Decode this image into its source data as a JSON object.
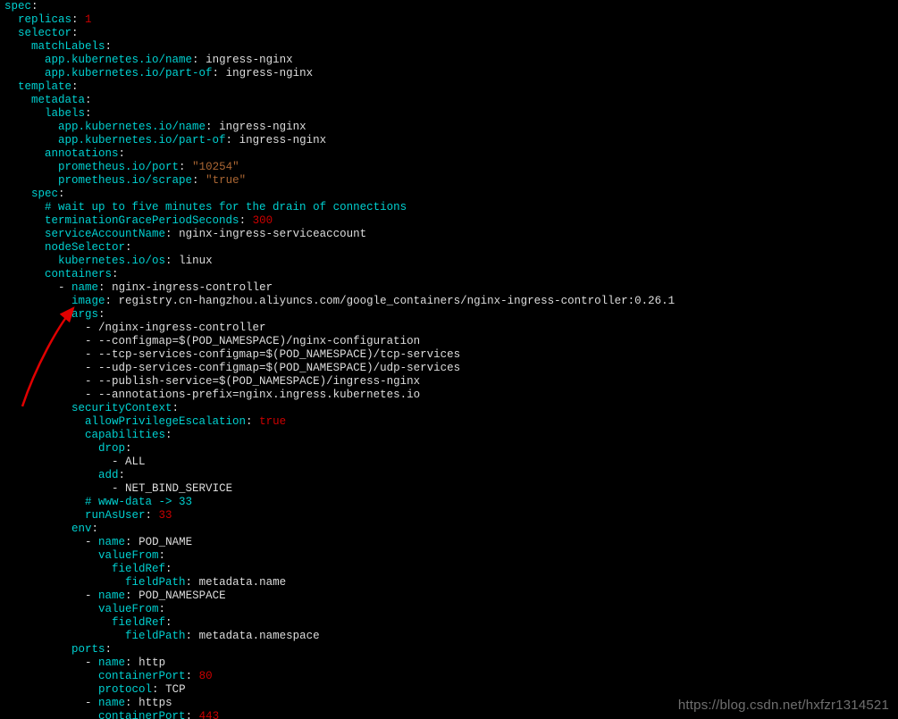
{
  "lines": [
    [
      {
        "cls": "k",
        "t": "spec"
      },
      {
        "cls": "p",
        "t": ":"
      }
    ],
    [
      {
        "cls": "p",
        "t": "  "
      },
      {
        "cls": "k",
        "t": "replicas"
      },
      {
        "cls": "p",
        "t": ": "
      },
      {
        "cls": "n",
        "t": "1"
      }
    ],
    [
      {
        "cls": "p",
        "t": "  "
      },
      {
        "cls": "k",
        "t": "selector"
      },
      {
        "cls": "p",
        "t": ":"
      }
    ],
    [
      {
        "cls": "p",
        "t": "    "
      },
      {
        "cls": "k",
        "t": "matchLabels"
      },
      {
        "cls": "p",
        "t": ":"
      }
    ],
    [
      {
        "cls": "p",
        "t": "      "
      },
      {
        "cls": "k",
        "t": "app.kubernetes.io/name"
      },
      {
        "cls": "p",
        "t": ": "
      },
      {
        "cls": "v",
        "t": "ingress-nginx"
      }
    ],
    [
      {
        "cls": "p",
        "t": "      "
      },
      {
        "cls": "k",
        "t": "app.kubernetes.io/part-of"
      },
      {
        "cls": "p",
        "t": ": "
      },
      {
        "cls": "v",
        "t": "ingress-nginx"
      }
    ],
    [
      {
        "cls": "p",
        "t": "  "
      },
      {
        "cls": "k",
        "t": "template"
      },
      {
        "cls": "p",
        "t": ":"
      }
    ],
    [
      {
        "cls": "p",
        "t": "    "
      },
      {
        "cls": "k",
        "t": "metadata"
      },
      {
        "cls": "p",
        "t": ":"
      }
    ],
    [
      {
        "cls": "p",
        "t": "      "
      },
      {
        "cls": "k",
        "t": "labels"
      },
      {
        "cls": "p",
        "t": ":"
      }
    ],
    [
      {
        "cls": "p",
        "t": "        "
      },
      {
        "cls": "k",
        "t": "app.kubernetes.io/name"
      },
      {
        "cls": "p",
        "t": ": "
      },
      {
        "cls": "v",
        "t": "ingress-nginx"
      }
    ],
    [
      {
        "cls": "p",
        "t": "        "
      },
      {
        "cls": "k",
        "t": "app.kubernetes.io/part-of"
      },
      {
        "cls": "p",
        "t": ": "
      },
      {
        "cls": "v",
        "t": "ingress-nginx"
      }
    ],
    [
      {
        "cls": "p",
        "t": "      "
      },
      {
        "cls": "k",
        "t": "annotations"
      },
      {
        "cls": "p",
        "t": ":"
      }
    ],
    [
      {
        "cls": "p",
        "t": "        "
      },
      {
        "cls": "k",
        "t": "prometheus.io/port"
      },
      {
        "cls": "p",
        "t": ": "
      },
      {
        "cls": "s",
        "t": "\"10254\""
      }
    ],
    [
      {
        "cls": "p",
        "t": "        "
      },
      {
        "cls": "k",
        "t": "prometheus.io/scrape"
      },
      {
        "cls": "p",
        "t": ": "
      },
      {
        "cls": "s",
        "t": "\"true\""
      }
    ],
    [
      {
        "cls": "p",
        "t": "    "
      },
      {
        "cls": "k",
        "t": "spec"
      },
      {
        "cls": "p",
        "t": ":"
      }
    ],
    [
      {
        "cls": "p",
        "t": "      "
      },
      {
        "cls": "c",
        "t": "# wait up to five minutes for the drain of connections"
      }
    ],
    [
      {
        "cls": "p",
        "t": "      "
      },
      {
        "cls": "k",
        "t": "terminationGracePeriodSeconds"
      },
      {
        "cls": "p",
        "t": ": "
      },
      {
        "cls": "n",
        "t": "300"
      }
    ],
    [
      {
        "cls": "p",
        "t": "      "
      },
      {
        "cls": "k",
        "t": "serviceAccountName"
      },
      {
        "cls": "p",
        "t": ": "
      },
      {
        "cls": "v",
        "t": "nginx-ingress-serviceaccount"
      }
    ],
    [
      {
        "cls": "p",
        "t": "      "
      },
      {
        "cls": "k",
        "t": "nodeSelector"
      },
      {
        "cls": "p",
        "t": ":"
      }
    ],
    [
      {
        "cls": "p",
        "t": "        "
      },
      {
        "cls": "k",
        "t": "kubernetes.io/os"
      },
      {
        "cls": "p",
        "t": ": "
      },
      {
        "cls": "v",
        "t": "linux"
      }
    ],
    [
      {
        "cls": "p",
        "t": "      "
      },
      {
        "cls": "k",
        "t": "containers"
      },
      {
        "cls": "p",
        "t": ":"
      }
    ],
    [
      {
        "cls": "p",
        "t": "        "
      },
      {
        "cls": "d",
        "t": "- "
      },
      {
        "cls": "k",
        "t": "name"
      },
      {
        "cls": "p",
        "t": ": "
      },
      {
        "cls": "v",
        "t": "nginx-ingress-controller"
      }
    ],
    [
      {
        "cls": "p",
        "t": "          "
      },
      {
        "cls": "k",
        "t": "image"
      },
      {
        "cls": "p",
        "t": ": "
      },
      {
        "cls": "v",
        "t": "registry.cn-hangzhou.aliyuncs.com/google_containers/nginx-ingress-controller:0.26.1"
      }
    ],
    [
      {
        "cls": "p",
        "t": "          "
      },
      {
        "cls": "k",
        "t": "args"
      },
      {
        "cls": "p",
        "t": ":"
      }
    ],
    [
      {
        "cls": "p",
        "t": "            "
      },
      {
        "cls": "d",
        "t": "- "
      },
      {
        "cls": "v",
        "t": "/nginx-ingress-controller"
      }
    ],
    [
      {
        "cls": "p",
        "t": "            "
      },
      {
        "cls": "d",
        "t": "- "
      },
      {
        "cls": "v",
        "t": "--configmap=$(POD_NAMESPACE)/nginx-configuration"
      }
    ],
    [
      {
        "cls": "p",
        "t": "            "
      },
      {
        "cls": "d",
        "t": "- "
      },
      {
        "cls": "v",
        "t": "--tcp-services-configmap=$(POD_NAMESPACE)/tcp-services"
      }
    ],
    [
      {
        "cls": "p",
        "t": "            "
      },
      {
        "cls": "d",
        "t": "- "
      },
      {
        "cls": "v",
        "t": "--udp-services-configmap=$(POD_NAMESPACE)/udp-services"
      }
    ],
    [
      {
        "cls": "p",
        "t": "            "
      },
      {
        "cls": "d",
        "t": "- "
      },
      {
        "cls": "v",
        "t": "--publish-service=$(POD_NAMESPACE)/ingress-nginx"
      }
    ],
    [
      {
        "cls": "p",
        "t": "            "
      },
      {
        "cls": "d",
        "t": "- "
      },
      {
        "cls": "v",
        "t": "--annotations-prefix=nginx.ingress.kubernetes.io"
      }
    ],
    [
      {
        "cls": "p",
        "t": "          "
      },
      {
        "cls": "k",
        "t": "securityContext"
      },
      {
        "cls": "p",
        "t": ":"
      }
    ],
    [
      {
        "cls": "p",
        "t": "            "
      },
      {
        "cls": "k",
        "t": "allowPrivilegeEscalation"
      },
      {
        "cls": "p",
        "t": ": "
      },
      {
        "cls": "n",
        "t": "true"
      }
    ],
    [
      {
        "cls": "p",
        "t": "            "
      },
      {
        "cls": "k",
        "t": "capabilities"
      },
      {
        "cls": "p",
        "t": ":"
      }
    ],
    [
      {
        "cls": "p",
        "t": "              "
      },
      {
        "cls": "k",
        "t": "drop"
      },
      {
        "cls": "p",
        "t": ":"
      }
    ],
    [
      {
        "cls": "p",
        "t": "                "
      },
      {
        "cls": "d",
        "t": "- "
      },
      {
        "cls": "v",
        "t": "ALL"
      }
    ],
    [
      {
        "cls": "p",
        "t": "              "
      },
      {
        "cls": "k",
        "t": "add"
      },
      {
        "cls": "p",
        "t": ":"
      }
    ],
    [
      {
        "cls": "p",
        "t": "                "
      },
      {
        "cls": "d",
        "t": "- "
      },
      {
        "cls": "v",
        "t": "NET_BIND_SERVICE"
      }
    ],
    [
      {
        "cls": "p",
        "t": "            "
      },
      {
        "cls": "c",
        "t": "# www-data -> 33"
      }
    ],
    [
      {
        "cls": "p",
        "t": "            "
      },
      {
        "cls": "k",
        "t": "runAsUser"
      },
      {
        "cls": "p",
        "t": ": "
      },
      {
        "cls": "n",
        "t": "33"
      }
    ],
    [
      {
        "cls": "p",
        "t": "          "
      },
      {
        "cls": "k",
        "t": "env"
      },
      {
        "cls": "p",
        "t": ":"
      }
    ],
    [
      {
        "cls": "p",
        "t": "            "
      },
      {
        "cls": "d",
        "t": "- "
      },
      {
        "cls": "k",
        "t": "name"
      },
      {
        "cls": "p",
        "t": ": "
      },
      {
        "cls": "v",
        "t": "POD_NAME"
      }
    ],
    [
      {
        "cls": "p",
        "t": "              "
      },
      {
        "cls": "k",
        "t": "valueFrom"
      },
      {
        "cls": "p",
        "t": ":"
      }
    ],
    [
      {
        "cls": "p",
        "t": "                "
      },
      {
        "cls": "k",
        "t": "fieldRef"
      },
      {
        "cls": "p",
        "t": ":"
      }
    ],
    [
      {
        "cls": "p",
        "t": "                  "
      },
      {
        "cls": "k",
        "t": "fieldPath"
      },
      {
        "cls": "p",
        "t": ": "
      },
      {
        "cls": "v",
        "t": "metadata.name"
      }
    ],
    [
      {
        "cls": "p",
        "t": "            "
      },
      {
        "cls": "d",
        "t": "- "
      },
      {
        "cls": "k",
        "t": "name"
      },
      {
        "cls": "p",
        "t": ": "
      },
      {
        "cls": "v",
        "t": "POD_NAMESPACE"
      }
    ],
    [
      {
        "cls": "p",
        "t": "              "
      },
      {
        "cls": "k",
        "t": "valueFrom"
      },
      {
        "cls": "p",
        "t": ":"
      }
    ],
    [
      {
        "cls": "p",
        "t": "                "
      },
      {
        "cls": "k",
        "t": "fieldRef"
      },
      {
        "cls": "p",
        "t": ":"
      }
    ],
    [
      {
        "cls": "p",
        "t": "                  "
      },
      {
        "cls": "k",
        "t": "fieldPath"
      },
      {
        "cls": "p",
        "t": ": "
      },
      {
        "cls": "v",
        "t": "metadata.namespace"
      }
    ],
    [
      {
        "cls": "p",
        "t": "          "
      },
      {
        "cls": "k",
        "t": "ports"
      },
      {
        "cls": "p",
        "t": ":"
      }
    ],
    [
      {
        "cls": "p",
        "t": "            "
      },
      {
        "cls": "d",
        "t": "- "
      },
      {
        "cls": "k",
        "t": "name"
      },
      {
        "cls": "p",
        "t": ": "
      },
      {
        "cls": "v",
        "t": "http"
      }
    ],
    [
      {
        "cls": "p",
        "t": "              "
      },
      {
        "cls": "k",
        "t": "containerPort"
      },
      {
        "cls": "p",
        "t": ": "
      },
      {
        "cls": "n",
        "t": "80"
      }
    ],
    [
      {
        "cls": "p",
        "t": "              "
      },
      {
        "cls": "k",
        "t": "protocol"
      },
      {
        "cls": "p",
        "t": ": "
      },
      {
        "cls": "v",
        "t": "TCP"
      }
    ],
    [
      {
        "cls": "p",
        "t": "            "
      },
      {
        "cls": "d",
        "t": "- "
      },
      {
        "cls": "k",
        "t": "name"
      },
      {
        "cls": "p",
        "t": ": "
      },
      {
        "cls": "v",
        "t": "https"
      }
    ],
    [
      {
        "cls": "p",
        "t": "              "
      },
      {
        "cls": "k",
        "t": "containerPort"
      },
      {
        "cls": "p",
        "t": ": "
      },
      {
        "cls": "n",
        "t": "443"
      }
    ]
  ],
  "watermark": "https://blog.csdn.net/hxfzr1314521"
}
